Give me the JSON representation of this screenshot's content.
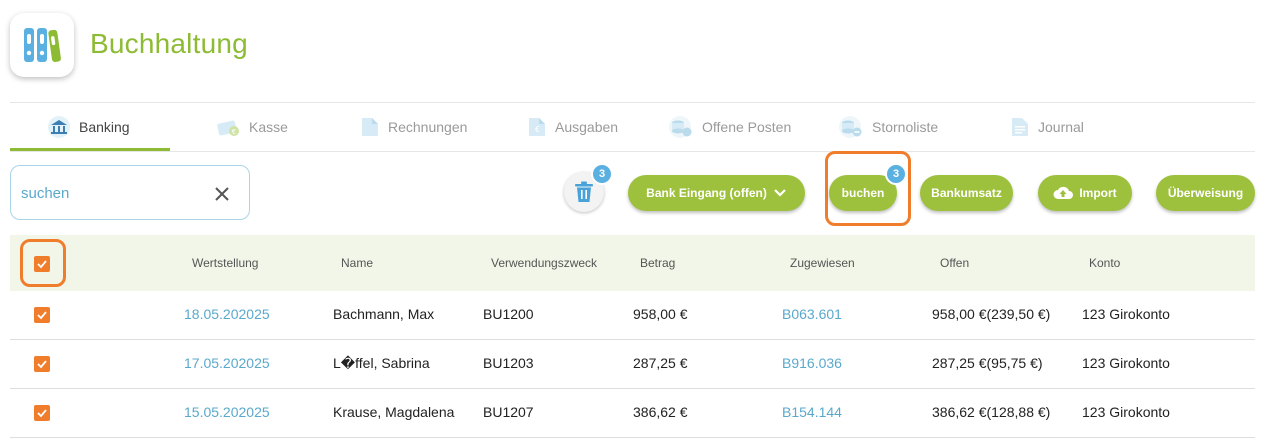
{
  "app": {
    "title": "Buchhaltung"
  },
  "colors": {
    "brand_green": "#8dbb33",
    "button_green": "#9ec13d",
    "link_blue": "#5aa9cc",
    "badge_blue": "#5ab0e0",
    "highlight_orange": "#f07d2b",
    "header_bg": "#f2f6e8"
  },
  "tabs": [
    {
      "label": "Banking",
      "icon": "bank-icon",
      "active": true
    },
    {
      "label": "Kasse",
      "icon": "cash-icon",
      "active": false
    },
    {
      "label": "Rechnungen",
      "icon": "document-icon",
      "active": false
    },
    {
      "label": "Ausgaben",
      "icon": "expense-document-icon",
      "active": false
    },
    {
      "label": "Offene Posten",
      "icon": "coins-icon",
      "active": false
    },
    {
      "label": "Stornoliste",
      "icon": "coins-cancel-icon",
      "active": false
    },
    {
      "label": "Journal",
      "icon": "journal-icon",
      "active": false
    }
  ],
  "search": {
    "placeholder": "suchen",
    "value": ""
  },
  "toolbar": {
    "trash_badge": "3",
    "bank_filter_label": "Bank Eingang (offen)",
    "buchen_label": "buchen",
    "buchen_badge": "3",
    "bankumsatz_label": "Bankumsatz",
    "import_label": "Import",
    "ueberweisung_label": "Überweisung"
  },
  "table": {
    "columns": [
      "Wertstellung",
      "Name",
      "Verwendungszweck",
      "Betrag",
      "Zugewiesen",
      "Offen",
      "Konto"
    ],
    "rows": [
      {
        "checked": true,
        "wertstellung": "18.05.202025",
        "name": "Bachmann, Max",
        "verwendungszweck": "BU1200",
        "betrag": "958,00 €",
        "zugewiesen": "B063.601",
        "offen": "958,00 €(239,50 €)",
        "konto": "123 Girokonto"
      },
      {
        "checked": true,
        "wertstellung": "17.05.202025",
        "name": "L�ffel, Sabrina",
        "verwendungszweck": "BU1203",
        "betrag": "287,25 €",
        "zugewiesen": "B916.036",
        "offen": "287,25 €(95,75 €)",
        "konto": "123 Girokonto"
      },
      {
        "checked": true,
        "wertstellung": "15.05.202025",
        "name": "Krause, Magdalena",
        "verwendungszweck": "BU1207",
        "betrag": "386,62 €",
        "zugewiesen": "B154.144",
        "offen": "386,62 €(128,88 €)",
        "konto": "123 Girokonto"
      }
    ]
  }
}
